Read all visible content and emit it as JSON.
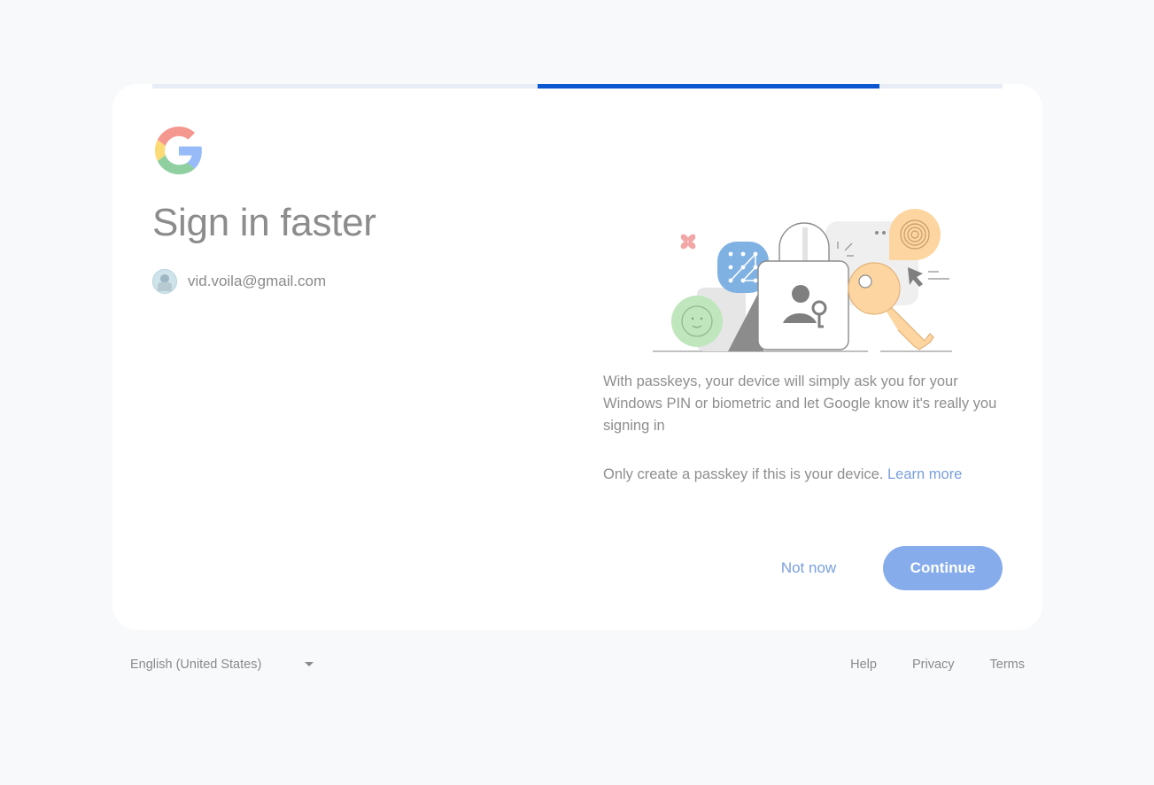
{
  "progress": {
    "fraction_start": 0.453,
    "fraction_end": 0.855
  },
  "heading": "Sign in faster",
  "account": {
    "email": "vid.voila@gmail.com"
  },
  "description": "With passkeys, your device will simply ask you for your Windows PIN or biometric and let Google know it's really you signing in",
  "note": {
    "text": "Only create a passkey if this is your device.",
    "link": "Learn more"
  },
  "actions": {
    "secondary": "Not now",
    "primary": "Continue"
  },
  "footer": {
    "language": "English (United States)",
    "links": [
      "Help",
      "Privacy",
      "Terms"
    ]
  },
  "colors": {
    "accent": "#0b57d0",
    "primary_button": "#86aceb",
    "link": "#7a9fdb",
    "background": "#f8f9fb"
  },
  "icons": [
    "google-logo-icon",
    "passkey-illustration",
    "dropdown-caret-icon"
  ]
}
